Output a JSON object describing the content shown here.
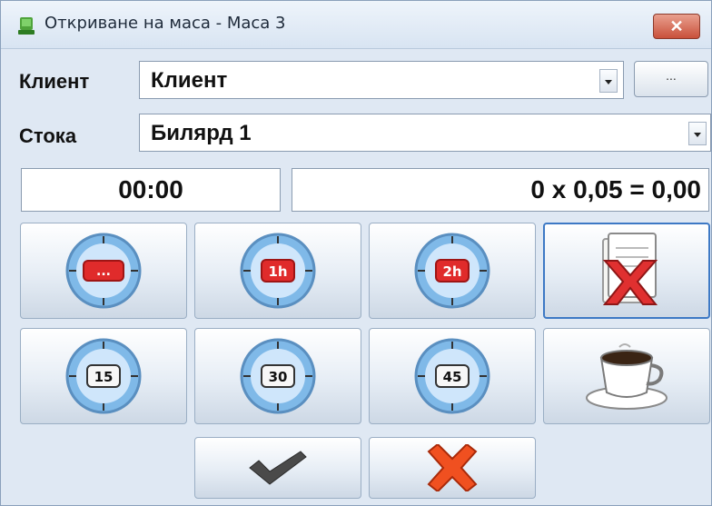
{
  "window": {
    "title": "Откриване на маса - Маса 3",
    "close_label": "✕"
  },
  "client": {
    "label": "Клиент",
    "value": "Клиент",
    "more_label": "..."
  },
  "product": {
    "label": "Стока",
    "value": "Билярд 1"
  },
  "time_display": "00:00",
  "price_display": "0 x 0,05 = 0,00",
  "timer_buttons": {
    "open_label": "...",
    "h1_label": "1h",
    "h2_label": "2h",
    "m15_label": "15",
    "m30_label": "30",
    "m45_label": "45"
  }
}
